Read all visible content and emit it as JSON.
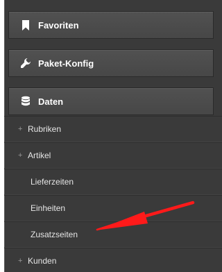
{
  "sections": [
    {
      "label": "Favoriten",
      "icon": "bookmark-icon"
    },
    {
      "label": "Paket-Konfig",
      "icon": "wrench-icon"
    },
    {
      "label": "Daten",
      "icon": "database-icon"
    }
  ],
  "daten_items": [
    {
      "label": "Rubriken",
      "expandable": true
    },
    {
      "label": "Artikel",
      "expandable": true
    },
    {
      "label": "Lieferzeiten",
      "expandable": false
    },
    {
      "label": "Einheiten",
      "expandable": false
    },
    {
      "label": "Zusatzseiten",
      "expandable": false
    },
    {
      "label": "Kunden",
      "expandable": true
    }
  ],
  "expand_symbol": "+",
  "colors": {
    "sidebar_bg": "#3a3a3a",
    "header_bg": "#4c4c4c",
    "text": "#ffffff",
    "arrow": "#ff1a1a"
  }
}
